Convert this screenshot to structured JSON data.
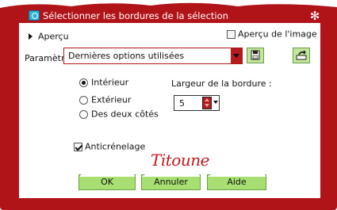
{
  "window": {
    "title": "Sélectionner les bordures de la sélection",
    "accent_color": "#b01418",
    "button_color": "#a7df72"
  },
  "preview": {
    "label": "Aperçu",
    "image_label": "Aperçu de l'image",
    "image_checked": false
  },
  "params": {
    "label": "Paramètres",
    "selected_value": "Dernières options utilisées"
  },
  "placement": {
    "options": [
      {
        "label": "Intérieur",
        "selected": true
      },
      {
        "label": "Extérieur",
        "selected": false
      },
      {
        "label": "Des deux côtés",
        "selected": false
      }
    ]
  },
  "border_width": {
    "label": "Largeur de la bordure :",
    "value": "5"
  },
  "antialias": {
    "label": "Anticrénelage",
    "checked": true
  },
  "signature": "Titoune",
  "buttons": {
    "ok": "OK",
    "cancel": "Annuler",
    "help": "Aide"
  }
}
